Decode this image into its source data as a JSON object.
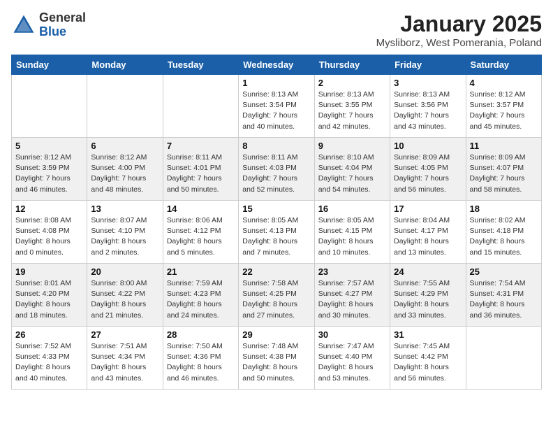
{
  "header": {
    "logo_general": "General",
    "logo_blue": "Blue",
    "month_title": "January 2025",
    "subtitle": "Mysliborz, West Pomerania, Poland"
  },
  "weekdays": [
    "Sunday",
    "Monday",
    "Tuesday",
    "Wednesday",
    "Thursday",
    "Friday",
    "Saturday"
  ],
  "weeks": [
    [
      {
        "day": "",
        "info": ""
      },
      {
        "day": "",
        "info": ""
      },
      {
        "day": "",
        "info": ""
      },
      {
        "day": "1",
        "info": "Sunrise: 8:13 AM\nSunset: 3:54 PM\nDaylight: 7 hours\nand 40 minutes."
      },
      {
        "day": "2",
        "info": "Sunrise: 8:13 AM\nSunset: 3:55 PM\nDaylight: 7 hours\nand 42 minutes."
      },
      {
        "day": "3",
        "info": "Sunrise: 8:13 AM\nSunset: 3:56 PM\nDaylight: 7 hours\nand 43 minutes."
      },
      {
        "day": "4",
        "info": "Sunrise: 8:12 AM\nSunset: 3:57 PM\nDaylight: 7 hours\nand 45 minutes."
      }
    ],
    [
      {
        "day": "5",
        "info": "Sunrise: 8:12 AM\nSunset: 3:59 PM\nDaylight: 7 hours\nand 46 minutes."
      },
      {
        "day": "6",
        "info": "Sunrise: 8:12 AM\nSunset: 4:00 PM\nDaylight: 7 hours\nand 48 minutes."
      },
      {
        "day": "7",
        "info": "Sunrise: 8:11 AM\nSunset: 4:01 PM\nDaylight: 7 hours\nand 50 minutes."
      },
      {
        "day": "8",
        "info": "Sunrise: 8:11 AM\nSunset: 4:03 PM\nDaylight: 7 hours\nand 52 minutes."
      },
      {
        "day": "9",
        "info": "Sunrise: 8:10 AM\nSunset: 4:04 PM\nDaylight: 7 hours\nand 54 minutes."
      },
      {
        "day": "10",
        "info": "Sunrise: 8:09 AM\nSunset: 4:05 PM\nDaylight: 7 hours\nand 56 minutes."
      },
      {
        "day": "11",
        "info": "Sunrise: 8:09 AM\nSunset: 4:07 PM\nDaylight: 7 hours\nand 58 minutes."
      }
    ],
    [
      {
        "day": "12",
        "info": "Sunrise: 8:08 AM\nSunset: 4:08 PM\nDaylight: 8 hours\nand 0 minutes."
      },
      {
        "day": "13",
        "info": "Sunrise: 8:07 AM\nSunset: 4:10 PM\nDaylight: 8 hours\nand 2 minutes."
      },
      {
        "day": "14",
        "info": "Sunrise: 8:06 AM\nSunset: 4:12 PM\nDaylight: 8 hours\nand 5 minutes."
      },
      {
        "day": "15",
        "info": "Sunrise: 8:05 AM\nSunset: 4:13 PM\nDaylight: 8 hours\nand 7 minutes."
      },
      {
        "day": "16",
        "info": "Sunrise: 8:05 AM\nSunset: 4:15 PM\nDaylight: 8 hours\nand 10 minutes."
      },
      {
        "day": "17",
        "info": "Sunrise: 8:04 AM\nSunset: 4:17 PM\nDaylight: 8 hours\nand 13 minutes."
      },
      {
        "day": "18",
        "info": "Sunrise: 8:02 AM\nSunset: 4:18 PM\nDaylight: 8 hours\nand 15 minutes."
      }
    ],
    [
      {
        "day": "19",
        "info": "Sunrise: 8:01 AM\nSunset: 4:20 PM\nDaylight: 8 hours\nand 18 minutes."
      },
      {
        "day": "20",
        "info": "Sunrise: 8:00 AM\nSunset: 4:22 PM\nDaylight: 8 hours\nand 21 minutes."
      },
      {
        "day": "21",
        "info": "Sunrise: 7:59 AM\nSunset: 4:23 PM\nDaylight: 8 hours\nand 24 minutes."
      },
      {
        "day": "22",
        "info": "Sunrise: 7:58 AM\nSunset: 4:25 PM\nDaylight: 8 hours\nand 27 minutes."
      },
      {
        "day": "23",
        "info": "Sunrise: 7:57 AM\nSunset: 4:27 PM\nDaylight: 8 hours\nand 30 minutes."
      },
      {
        "day": "24",
        "info": "Sunrise: 7:55 AM\nSunset: 4:29 PM\nDaylight: 8 hours\nand 33 minutes."
      },
      {
        "day": "25",
        "info": "Sunrise: 7:54 AM\nSunset: 4:31 PM\nDaylight: 8 hours\nand 36 minutes."
      }
    ],
    [
      {
        "day": "26",
        "info": "Sunrise: 7:52 AM\nSunset: 4:33 PM\nDaylight: 8 hours\nand 40 minutes."
      },
      {
        "day": "27",
        "info": "Sunrise: 7:51 AM\nSunset: 4:34 PM\nDaylight: 8 hours\nand 43 minutes."
      },
      {
        "day": "28",
        "info": "Sunrise: 7:50 AM\nSunset: 4:36 PM\nDaylight: 8 hours\nand 46 minutes."
      },
      {
        "day": "29",
        "info": "Sunrise: 7:48 AM\nSunset: 4:38 PM\nDaylight: 8 hours\nand 50 minutes."
      },
      {
        "day": "30",
        "info": "Sunrise: 7:47 AM\nSunset: 4:40 PM\nDaylight: 8 hours\nand 53 minutes."
      },
      {
        "day": "31",
        "info": "Sunrise: 7:45 AM\nSunset: 4:42 PM\nDaylight: 8 hours\nand 56 minutes."
      },
      {
        "day": "",
        "info": ""
      }
    ]
  ]
}
